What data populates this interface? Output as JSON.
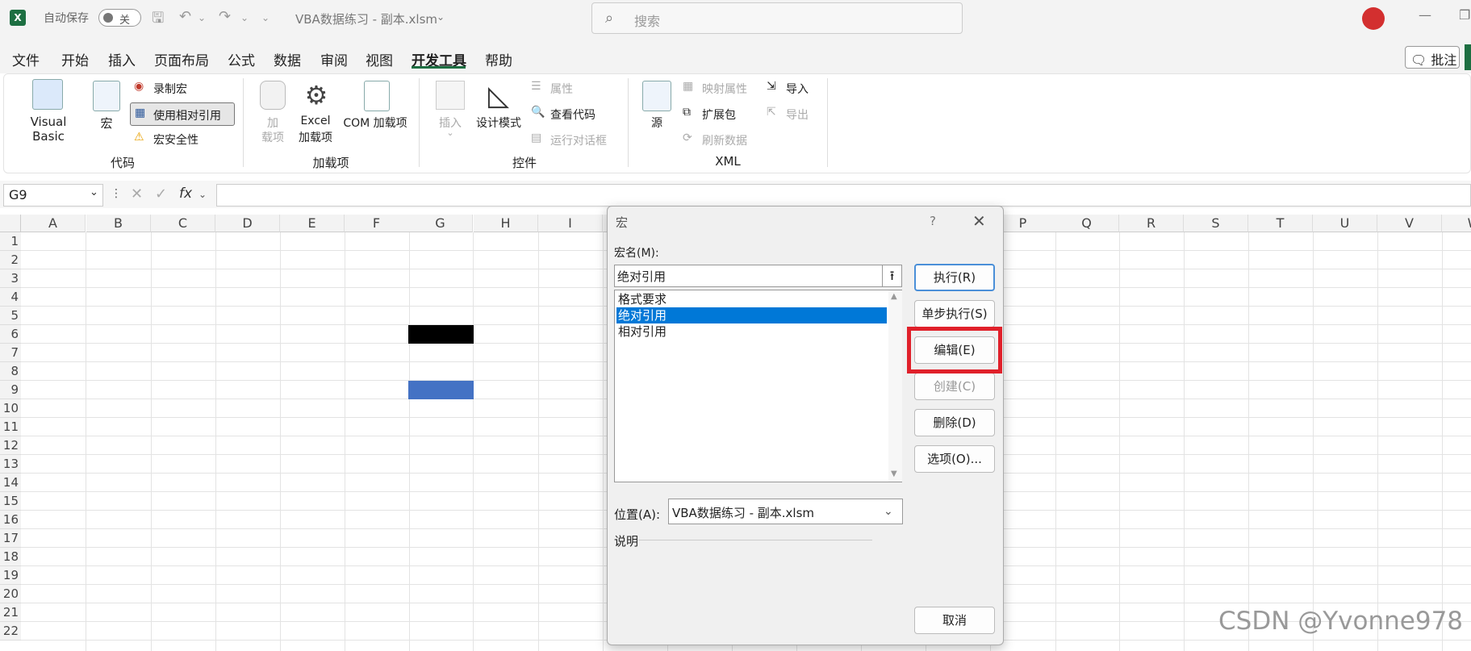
{
  "titlebar": {
    "autosave_label": "自动保存",
    "autosave_state": "关",
    "doc_title": "VBA数据练习 - 副本.xlsm",
    "search_placeholder": "搜索"
  },
  "menu": {
    "tabs": [
      "文件",
      "开始",
      "插入",
      "页面布局",
      "公式",
      "数据",
      "审阅",
      "视图",
      "开发工具",
      "帮助"
    ],
    "comment_label": "批注"
  },
  "ribbon": {
    "code": {
      "visual_basic": "Visual Basic",
      "macro": "宏",
      "record_macro": "录制宏",
      "relative_ref": "使用相对引用",
      "macro_security": "宏安全性",
      "group": "代码"
    },
    "addins": {
      "addin_l1": "加",
      "addin_l2": "载项",
      "excel_l1": "Excel",
      "excel_l2": "加载项",
      "com": "COM 加载项",
      "group": "加载项"
    },
    "controls": {
      "insert": "插入",
      "design_mode": "设计模式",
      "properties": "属性",
      "view_code": "查看代码",
      "run_dialog": "运行对话框",
      "group": "控件"
    },
    "xml": {
      "source": "源",
      "map_props": "映射属性",
      "expansion": "扩展包",
      "refresh": "刷新数据",
      "import": "导入",
      "export": "导出",
      "group": "XML"
    }
  },
  "formula_bar": {
    "namebox": "G9",
    "fx": "fx"
  },
  "grid": {
    "columns": [
      "A",
      "B",
      "C",
      "D",
      "E",
      "F",
      "G",
      "H",
      "I",
      "",
      "",
      "",
      "",
      "",
      "",
      "P",
      "Q",
      "R",
      "S",
      "T",
      "U",
      "V",
      "W"
    ],
    "rows": [
      "1",
      "2",
      "3",
      "4",
      "5",
      "6",
      "7",
      "8",
      "9",
      "10",
      "11",
      "12",
      "13",
      "14",
      "15",
      "16",
      "17",
      "18",
      "19",
      "20",
      "21",
      "22"
    ]
  },
  "dialog": {
    "title": "宏",
    "help": "?",
    "macro_name_label": "宏名(M):",
    "macro_name_value": "绝对引用",
    "macros": [
      "格式要求",
      "绝对引用",
      "相对引用"
    ],
    "selected_index": 1,
    "buttons": {
      "run": "执行(R)",
      "step": "单步执行(S)",
      "edit": "编辑(E)",
      "create": "创建(C)",
      "delete": "删除(D)",
      "options": "选项(O)...",
      "cancel": "取消"
    },
    "location_label": "位置(A):",
    "location_value": "VBA数据练习 - 副本.xlsm",
    "description_label": "说明"
  },
  "watermark": "CSDN @Yvonne978",
  "colors": {
    "excel_green": "#1d6f42",
    "selection_blue": "#0078d7",
    "cell_blue": "#4472c4",
    "highlight_red": "#e0202a"
  }
}
